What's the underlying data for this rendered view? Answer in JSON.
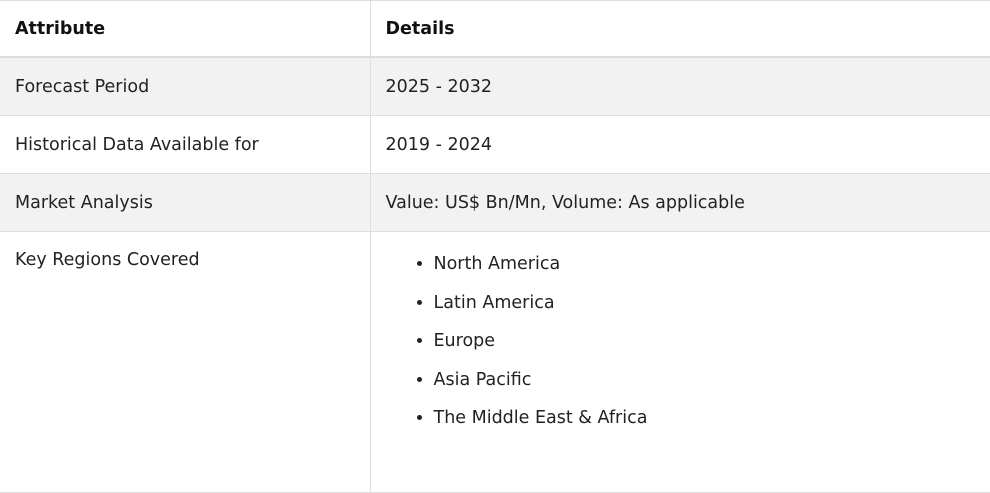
{
  "table": {
    "headers": [
      "Attribute",
      "Details"
    ],
    "rows": [
      {
        "attribute": "Forecast Period",
        "details": "2025 - 2032"
      },
      {
        "attribute": "Historical Data Available for",
        "details": "2019 - 2024"
      },
      {
        "attribute": "Market Analysis",
        "details": "Value: US$ Bn/Mn, Volume: As applicable"
      },
      {
        "attribute": "Key Regions Covered",
        "details_list": [
          "North America",
          "Latin America",
          "Europe",
          "Asia Pacific",
          "The Middle East & Africa"
        ]
      }
    ]
  }
}
